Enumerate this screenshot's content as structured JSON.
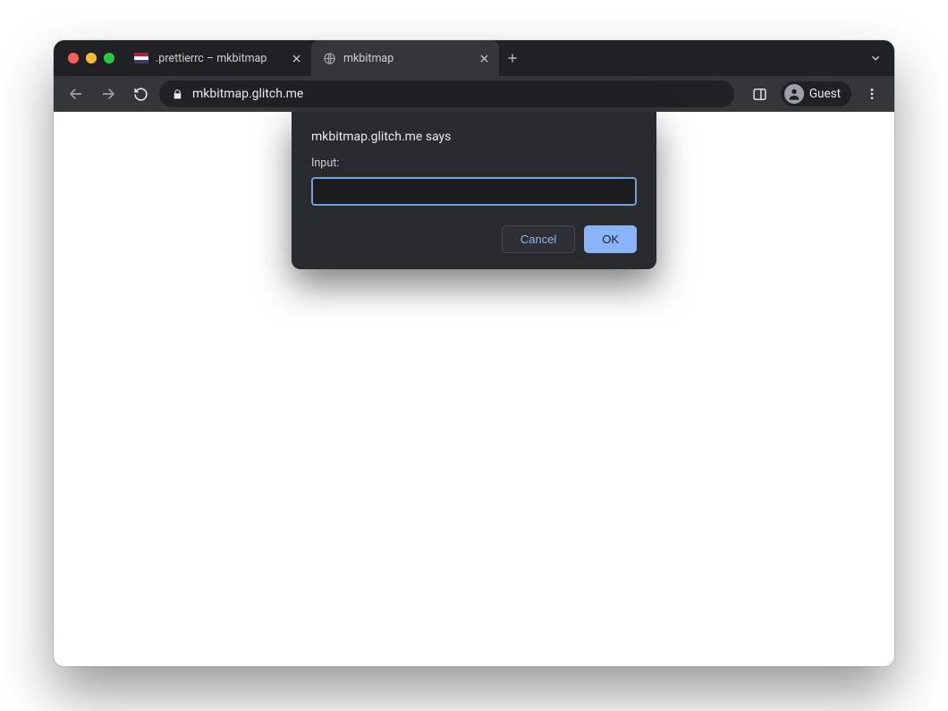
{
  "tabs": [
    {
      "title": ".prettierrc – mkbitmap",
      "active": false
    },
    {
      "title": "mkbitmap",
      "active": true
    }
  ],
  "addressbar": {
    "url": "mkbitmap.glitch.me"
  },
  "profile": {
    "label": "Guest"
  },
  "dialog": {
    "origin": "mkbitmap.glitch.me says",
    "prompt_label": "Input:",
    "input_value": "",
    "cancel_label": "Cancel",
    "ok_label": "OK"
  }
}
